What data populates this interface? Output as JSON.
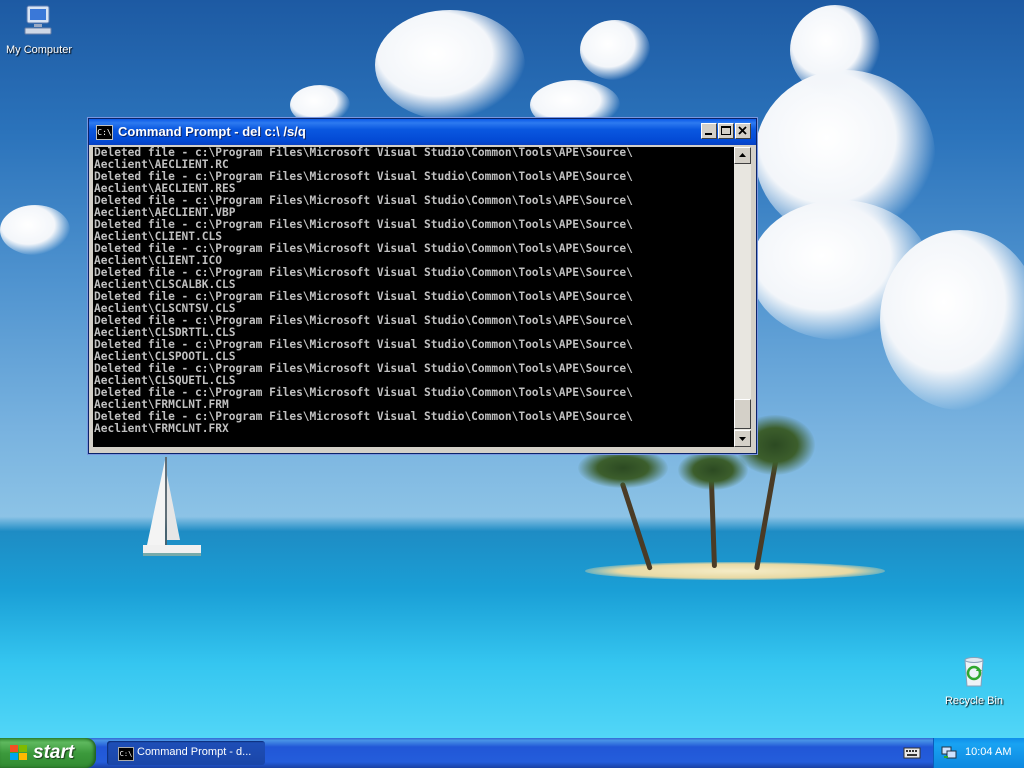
{
  "desktop": {
    "icons": [
      {
        "label": "My Computer",
        "icon": "my-computer-icon"
      },
      {
        "label": "Recycle Bin",
        "icon": "recycle-bin-icon"
      }
    ]
  },
  "window": {
    "title": "Command Prompt - del c:\\ /s/q",
    "icon": "console-icon",
    "console_lines": [
      "Deleted file - c:\\Program Files\\Microsoft Visual Studio\\Common\\Tools\\APE\\Source\\",
      "Aeclient\\AECLIENT.RC",
      "Deleted file - c:\\Program Files\\Microsoft Visual Studio\\Common\\Tools\\APE\\Source\\",
      "Aeclient\\AECLIENT.RES",
      "Deleted file - c:\\Program Files\\Microsoft Visual Studio\\Common\\Tools\\APE\\Source\\",
      "Aeclient\\AECLIENT.VBP",
      "Deleted file - c:\\Program Files\\Microsoft Visual Studio\\Common\\Tools\\APE\\Source\\",
      "Aeclient\\CLIENT.CLS",
      "Deleted file - c:\\Program Files\\Microsoft Visual Studio\\Common\\Tools\\APE\\Source\\",
      "Aeclient\\CLIENT.ICO",
      "Deleted file - c:\\Program Files\\Microsoft Visual Studio\\Common\\Tools\\APE\\Source\\",
      "Aeclient\\CLSCALBK.CLS",
      "Deleted file - c:\\Program Files\\Microsoft Visual Studio\\Common\\Tools\\APE\\Source\\",
      "Aeclient\\CLSCNTSV.CLS",
      "Deleted file - c:\\Program Files\\Microsoft Visual Studio\\Common\\Tools\\APE\\Source\\",
      "Aeclient\\CLSDRTTL.CLS",
      "Deleted file - c:\\Program Files\\Microsoft Visual Studio\\Common\\Tools\\APE\\Source\\",
      "Aeclient\\CLSPOOTL.CLS",
      "Deleted file - c:\\Program Files\\Microsoft Visual Studio\\Common\\Tools\\APE\\Source\\",
      "Aeclient\\CLSQUETL.CLS",
      "Deleted file - c:\\Program Files\\Microsoft Visual Studio\\Common\\Tools\\APE\\Source\\",
      "Aeclient\\FRMCLNT.FRM",
      "Deleted file - c:\\Program Files\\Microsoft Visual Studio\\Common\\Tools\\APE\\Source\\",
      "Aeclient\\FRMCLNT.FRX"
    ],
    "console_colors": {
      "background": "#000000",
      "text": "#c0c0c0"
    }
  },
  "taskbar": {
    "start_label": "start",
    "task_label": "Command Prompt - d...",
    "clock": "10:04 AM"
  },
  "colors": {
    "titlebar": "#0a58e0",
    "taskbar": "#245ddb",
    "start_button": "#3c9a3c",
    "tray": "#0f8ee9"
  }
}
